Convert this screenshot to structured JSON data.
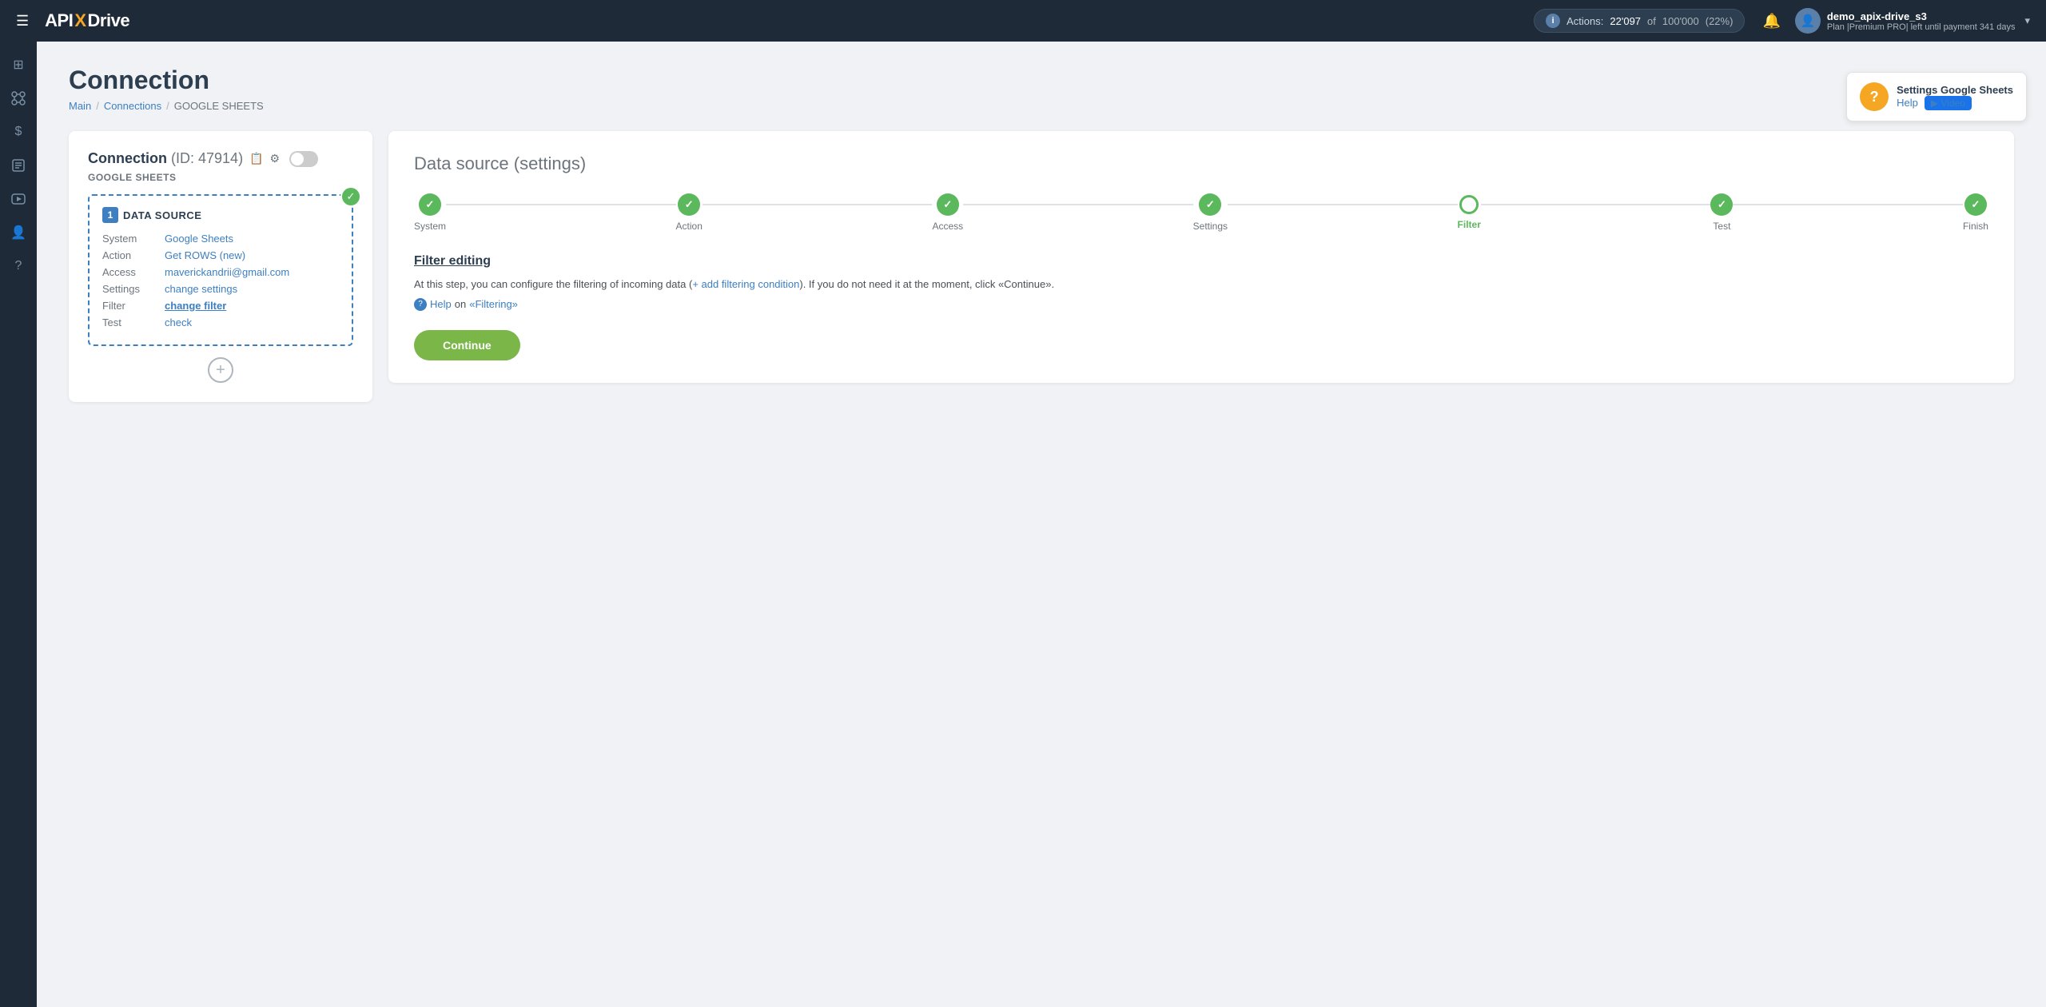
{
  "topnav": {
    "hamburger": "☰",
    "logo": {
      "api": "API",
      "x": "X",
      "drive": "Drive"
    },
    "actions": {
      "label": "Actions:",
      "count": "22'097",
      "of_text": "of",
      "total": "100'000",
      "pct": "(22%)"
    },
    "bell_icon": "🔔",
    "user": {
      "name": "demo_apix-drive_s3",
      "plan": "Plan |Premium PRO| left until payment 341 days",
      "avatar_icon": "👤"
    },
    "chevron": "▾"
  },
  "sidebar": {
    "items": [
      {
        "icon": "⊞",
        "name": "dashboard-icon"
      },
      {
        "icon": "⋮⋮",
        "name": "connections-icon"
      },
      {
        "icon": "$",
        "name": "billing-icon"
      },
      {
        "icon": "🗂",
        "name": "tasks-icon"
      },
      {
        "icon": "▶",
        "name": "youtube-icon"
      },
      {
        "icon": "👤",
        "name": "profile-icon"
      },
      {
        "icon": "?",
        "name": "help-icon"
      }
    ]
  },
  "help_widget": {
    "title": "Settings Google Sheets",
    "help_label": "Help",
    "video_label": "▶ Video"
  },
  "page": {
    "title": "Connection",
    "breadcrumb": {
      "main": "Main",
      "connections": "Connections",
      "current": "GOOGLE SHEETS"
    }
  },
  "left_card": {
    "title": "Connection",
    "id_text": "(ID: 47914)",
    "copy_icon": "📋",
    "settings_icon": "⚙",
    "service_label": "GOOGLE SHEETS",
    "datasource_box": {
      "number": "1",
      "title": "DATA SOURCE",
      "rows": [
        {
          "label": "System",
          "value": "Google Sheets",
          "type": "link"
        },
        {
          "label": "Action",
          "value": "Get ROWS (new)",
          "type": "link"
        },
        {
          "label": "Access",
          "value": "maverickandrii@gmail.com",
          "type": "link"
        },
        {
          "label": "Settings",
          "value": "change settings",
          "type": "link"
        },
        {
          "label": "Filter",
          "value": "change filter",
          "type": "active"
        },
        {
          "label": "Test",
          "value": "check",
          "type": "link"
        }
      ]
    },
    "add_icon": "+"
  },
  "right_card": {
    "title": "Data source",
    "title_sub": "(settings)",
    "steps": [
      {
        "label": "System",
        "state": "done"
      },
      {
        "label": "Action",
        "state": "done"
      },
      {
        "label": "Access",
        "state": "done"
      },
      {
        "label": "Settings",
        "state": "done"
      },
      {
        "label": "Filter",
        "state": "active"
      },
      {
        "label": "Test",
        "state": "done"
      },
      {
        "label": "Finish",
        "state": "done"
      }
    ],
    "filter": {
      "title": "Filter editing",
      "desc_before": "At this step, you can configure the filtering of incoming data (",
      "add_link": "+ add filtering condition",
      "desc_after": "). If you do not need it at the moment, click «Continue».",
      "help_text": "Help",
      "help_on": "on",
      "filtering_link": "«Filtering»"
    },
    "continue_btn": "Continue"
  }
}
